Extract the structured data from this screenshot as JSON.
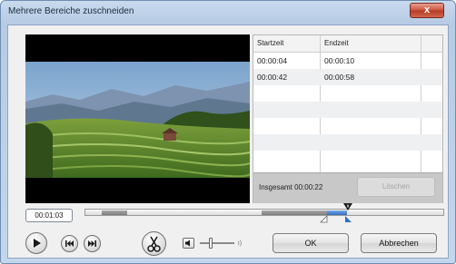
{
  "window": {
    "title": "Mehrere Bereiche zuschneiden",
    "close_label": "x"
  },
  "table": {
    "columns": [
      "Startzeit",
      "Endzeit"
    ],
    "rows": [
      {
        "start": "00:00:04",
        "end": "00:00:10"
      },
      {
        "start": "00:00:42",
        "end": "00:00:58"
      }
    ],
    "total_text": "Insgesamt 00:00:22",
    "delete_label": "Löschen"
  },
  "player": {
    "current_time": "00:01:03",
    "volume_level": 0.3
  },
  "buttons": {
    "ok": "OK",
    "cancel": "Abbrechen"
  },
  "icons": [
    "play-icon",
    "previous-icon",
    "next-icon",
    "scissors-icon",
    "speaker-icon",
    "volume-waves-icon"
  ]
}
